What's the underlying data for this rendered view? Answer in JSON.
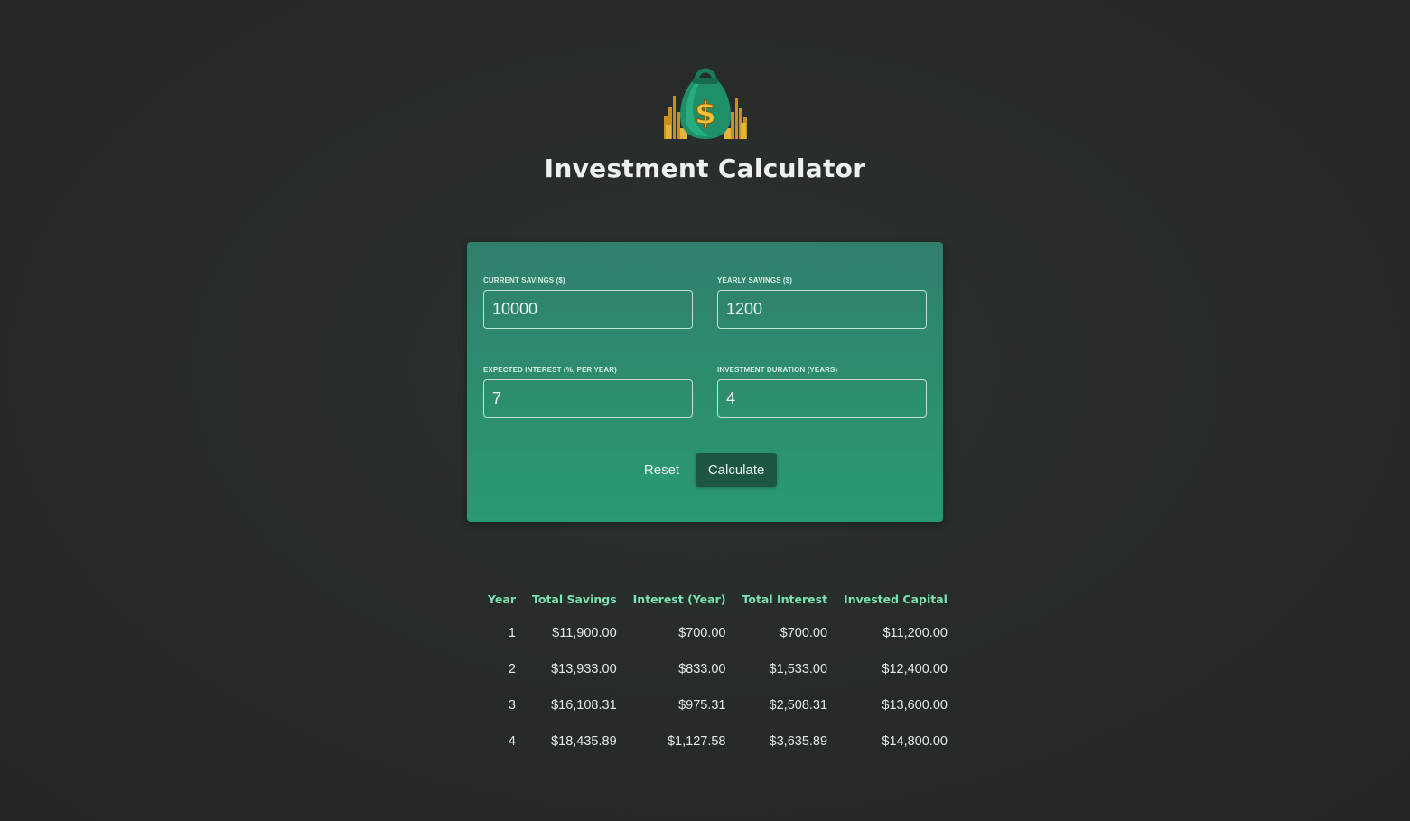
{
  "app": {
    "title": "Investment Calculator",
    "logo_icon": "money-bag-icon",
    "colors": {
      "background": "#262b29",
      "card": "#2b8f70",
      "accent_text": "#7be0b4",
      "button": "#1d5647"
    }
  },
  "form": {
    "fields": [
      {
        "label": "Current Savings ($)",
        "value": "10000"
      },
      {
        "label": "Yearly Savings ($)",
        "value": "1200"
      },
      {
        "label": "Expected Interest (%, per year)",
        "value": "7"
      },
      {
        "label": "Investment Duration (years)",
        "value": "4"
      }
    ],
    "reset_label": "Reset",
    "calculate_label": "Calculate"
  },
  "results": {
    "headers": [
      "Year",
      "Total Savings",
      "Interest (Year)",
      "Total Interest",
      "Invested Capital"
    ],
    "rows": [
      [
        "1",
        "$11,900.00",
        "$700.00",
        "$700.00",
        "$11,200.00"
      ],
      [
        "2",
        "$13,933.00",
        "$833.00",
        "$1,533.00",
        "$12,400.00"
      ],
      [
        "3",
        "$16,108.31",
        "$975.31",
        "$2,508.31",
        "$13,600.00"
      ],
      [
        "4",
        "$18,435.89",
        "$1,127.58",
        "$3,635.89",
        "$14,800.00"
      ]
    ]
  }
}
